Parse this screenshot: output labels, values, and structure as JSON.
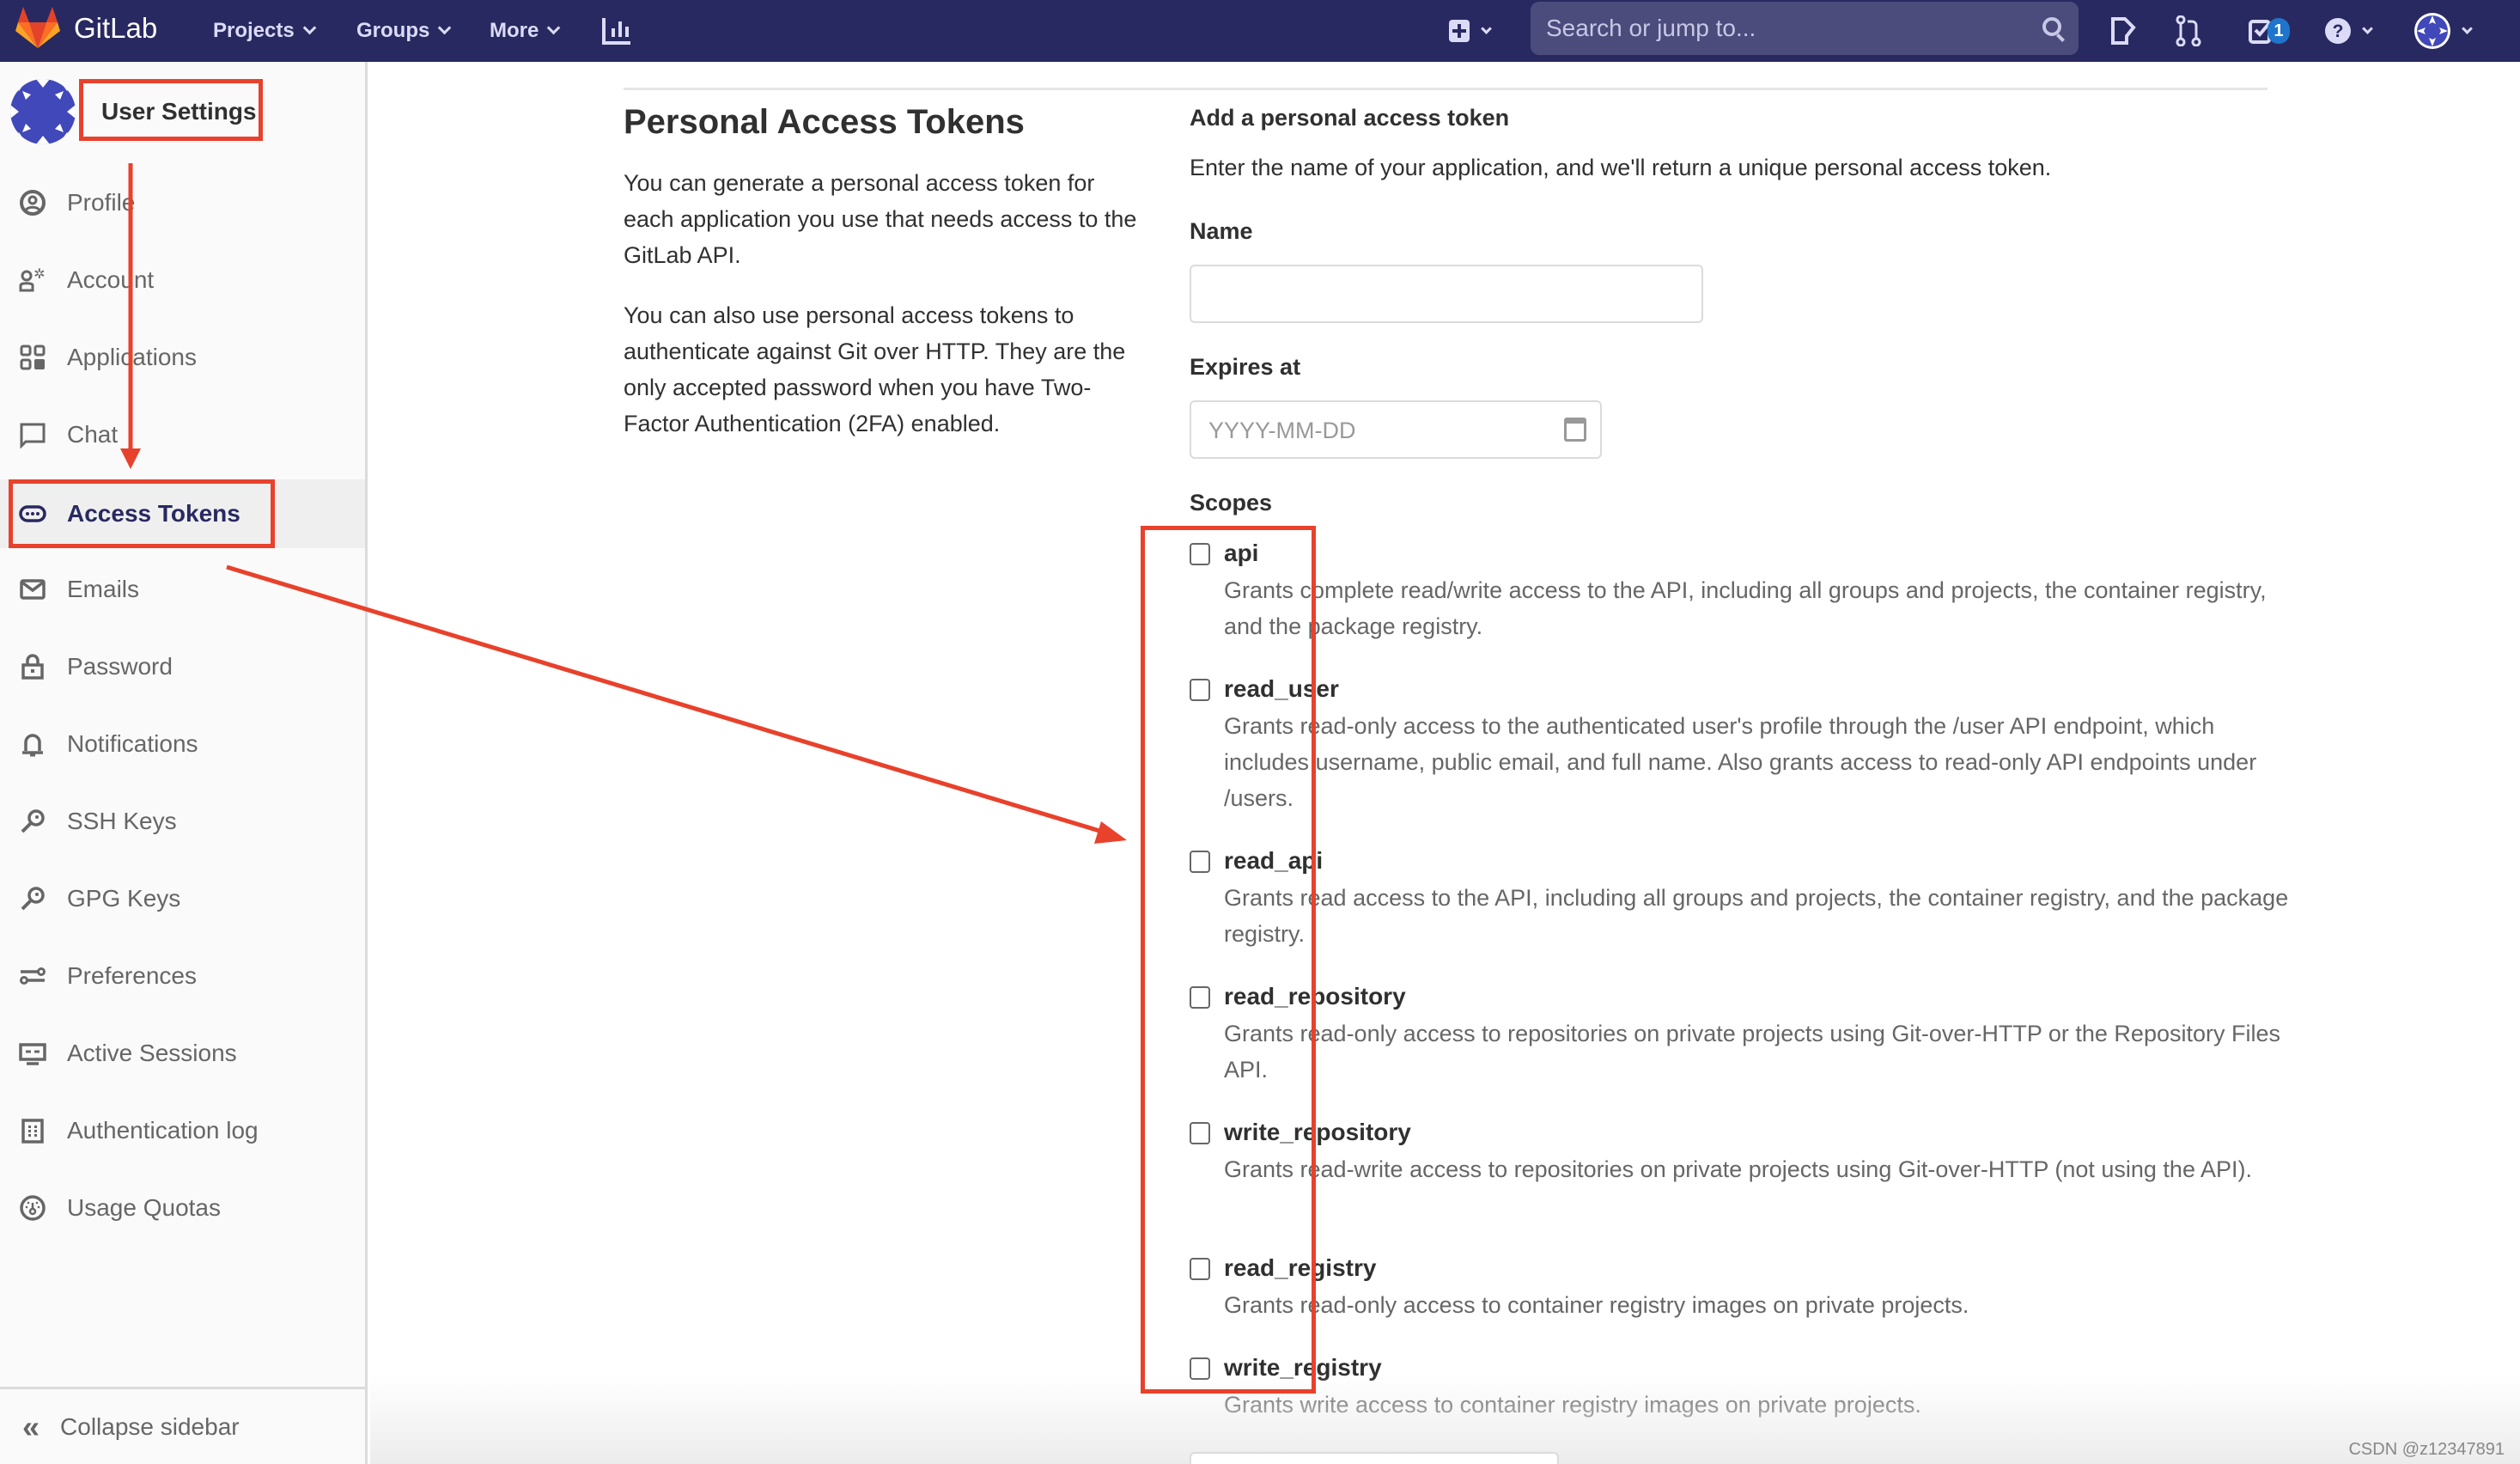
{
  "topbar": {
    "brand": "GitLab",
    "nav": [
      {
        "label": "Projects"
      },
      {
        "label": "Groups"
      },
      {
        "label": "More"
      }
    ],
    "search_placeholder": "Search or jump to...",
    "todo_count": "1",
    "icons": [
      "plus-square-icon",
      "issues-icon",
      "merge-request-icon",
      "todo-icon",
      "help-icon",
      "user-avatar-icon"
    ]
  },
  "sidebar": {
    "title": "User Settings",
    "items": [
      {
        "label": "Profile",
        "icon": "profile-icon"
      },
      {
        "label": "Account",
        "icon": "account-icon"
      },
      {
        "label": "Applications",
        "icon": "applications-icon"
      },
      {
        "label": "Chat",
        "icon": "chat-icon"
      },
      {
        "label": "Access Tokens",
        "icon": "token-icon",
        "active": true
      },
      {
        "label": "Emails",
        "icon": "mail-icon"
      },
      {
        "label": "Password",
        "icon": "lock-icon"
      },
      {
        "label": "Notifications",
        "icon": "bell-icon"
      },
      {
        "label": "SSH Keys",
        "icon": "key-icon"
      },
      {
        "label": "GPG Keys",
        "icon": "key-icon"
      },
      {
        "label": "Preferences",
        "icon": "preferences-icon"
      },
      {
        "label": "Active Sessions",
        "icon": "monitor-icon"
      },
      {
        "label": "Authentication log",
        "icon": "log-icon"
      },
      {
        "label": "Usage Quotas",
        "icon": "gauge-icon"
      }
    ],
    "collapse_label": "Collapse sidebar"
  },
  "main": {
    "title": "Personal Access Tokens",
    "intro_1": "You can generate a personal access token for each application you use that needs access to the GitLab API.",
    "intro_2": "You can also use personal access tokens to authenticate against Git over HTTP. They are the only accepted password when you have Two-Factor Authentication (2FA) enabled.",
    "form_title": "Add a personal access token",
    "form_desc": "Enter the name of your application, and we'll return a unique personal access token.",
    "name_label": "Name",
    "name_value": "",
    "expires_label": "Expires at",
    "expires_placeholder": "YYYY-MM-DD",
    "scopes_label": "Scopes",
    "scopes": [
      {
        "name": "api",
        "checked": false,
        "desc": "Grants complete read/write access to the API, including all groups and projects, the container registry, and the package registry."
      },
      {
        "name": "read_user",
        "checked": false,
        "desc": "Grants read-only access to the authenticated user's profile through the /user API endpoint, which includes username, public email, and full name. Also grants access to read-only API endpoints under /users."
      },
      {
        "name": "read_api",
        "checked": false,
        "desc": "Grants read access to the API, including all groups and projects, the container registry, and the package registry."
      },
      {
        "name": "read_repository",
        "checked": false,
        "desc": "Grants read-only access to repositories on private projects using Git-over-HTTP or the Repository Files API."
      },
      {
        "name": "write_repository",
        "checked": false,
        "desc": "Grants read-write access to repositories on private projects using Git-over-HTTP (not using the API)."
      },
      {
        "name": "read_registry",
        "checked": false,
        "desc": "Grants read-only access to container registry images on private projects."
      },
      {
        "name": "write_registry",
        "checked": false,
        "desc": "Grants write access to container registry images on private projects."
      }
    ]
  },
  "watermark": "CSDN @z12347891",
  "colors": {
    "topbar": "#292961",
    "accent": "#292961",
    "annotation": "#e8412c",
    "badge": "#1f75cb"
  }
}
